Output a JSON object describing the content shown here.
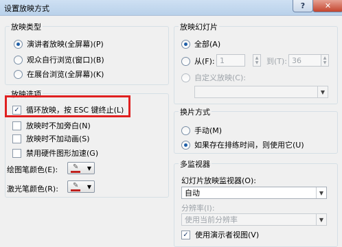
{
  "window": {
    "title": "设置放映方式",
    "help_label": "?",
    "close_label": "✕"
  },
  "show_type": {
    "title": "放映类型",
    "options": [
      {
        "label": "演讲者放映(全屏幕)(P)",
        "selected": true
      },
      {
        "label": "观众自行浏览(窗口)(B)",
        "selected": false
      },
      {
        "label": "在展台浏览(全屏幕)(K)",
        "selected": false
      }
    ]
  },
  "show_options": {
    "title": "放映选项",
    "items": [
      {
        "label": "循环放映，按 ESC 键终止(L)",
        "checked": true
      },
      {
        "label": "放映时不加旁白(N)",
        "checked": false
      },
      {
        "label": "放映时不加动画(S)",
        "checked": false
      },
      {
        "label": "禁用硬件图形加速(G)",
        "checked": false
      }
    ],
    "pen_color_label": "绘图笔颜色(E):",
    "laser_color_label": "激光笔颜色(R):",
    "pen_color": "#c0211e",
    "laser_color": "#c0211e"
  },
  "slides": {
    "title": "放映幻灯片",
    "all_label": "全部(A)",
    "from_label": "从(F):",
    "from_value": "1",
    "to_label": "到(T):",
    "to_value": "36",
    "custom_label": "自定义放映(C):",
    "custom_value": ""
  },
  "advance": {
    "title": "换片方式",
    "manual_label": "手动(M)",
    "timing_label": "如果存在排练时间，则使用它(U)"
  },
  "monitors": {
    "title": "多监视器",
    "monitor_label": "幻灯片放映监视器(O):",
    "monitor_value": "自动",
    "resolution_label": "分辨率(I):",
    "resolution_value": "使用当前分辨率",
    "presenter_view_label": "使用演示者视图(V)",
    "presenter_view_checked": true
  }
}
